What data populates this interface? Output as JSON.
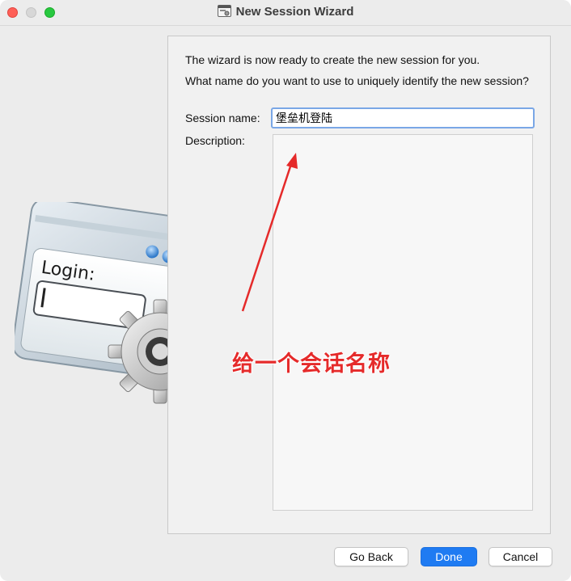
{
  "window": {
    "title": "New Session Wizard"
  },
  "wizard": {
    "intro_text": "The wizard is now ready to create the new session for you.",
    "question_text": "What name do you want to use to uniquely identify the new session?",
    "session_name_label": "Session name:",
    "session_name_value": "堡垒机登陆",
    "description_label": "Description:",
    "description_value": "",
    "hero_login_label": "Login:"
  },
  "annotation": {
    "text": "给一个会话名称",
    "color": "#e52a2a"
  },
  "buttons": {
    "go_back": "Go Back",
    "done": "Done",
    "cancel": "Cancel"
  },
  "colors": {
    "accent": "#1f7bf2",
    "close": "#fe5f57",
    "maximize": "#28c840"
  }
}
